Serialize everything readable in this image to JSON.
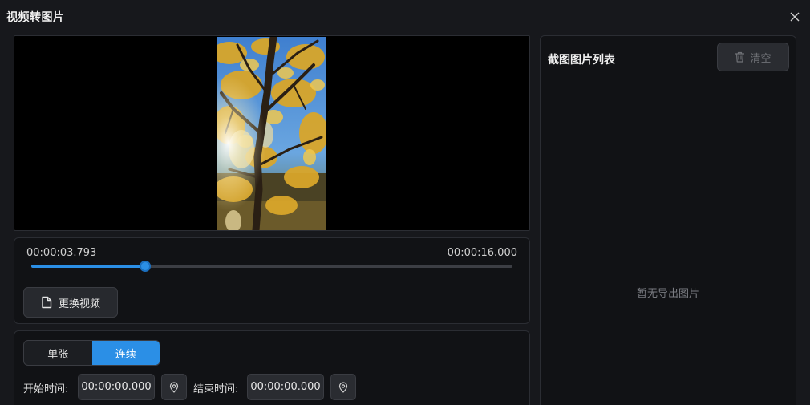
{
  "window": {
    "title": "视频转图片"
  },
  "player": {
    "current_time": "00:00:03.793",
    "total_time": "00:00:16.000",
    "progress": 0.2371,
    "replace_button_label": "更换视频"
  },
  "mode": {
    "options": [
      "单张",
      "连续"
    ],
    "selected": "连续"
  },
  "range": {
    "start_label": "开始时间:",
    "start_value": "00:00:00.000",
    "end_label": "结束时间:",
    "end_value": "00:00:00.000"
  },
  "snapshot_list": {
    "title": "截图图片列表",
    "clear_label": "清空",
    "empty_text": "暂无导出图片"
  },
  "icons": {
    "close": "close-icon",
    "file": "file-icon",
    "location_pin": "location-pin-icon",
    "trash": "trash-icon"
  },
  "colors": {
    "accent": "#2b8fe6",
    "background": "#17181c",
    "panel": "#111215"
  }
}
